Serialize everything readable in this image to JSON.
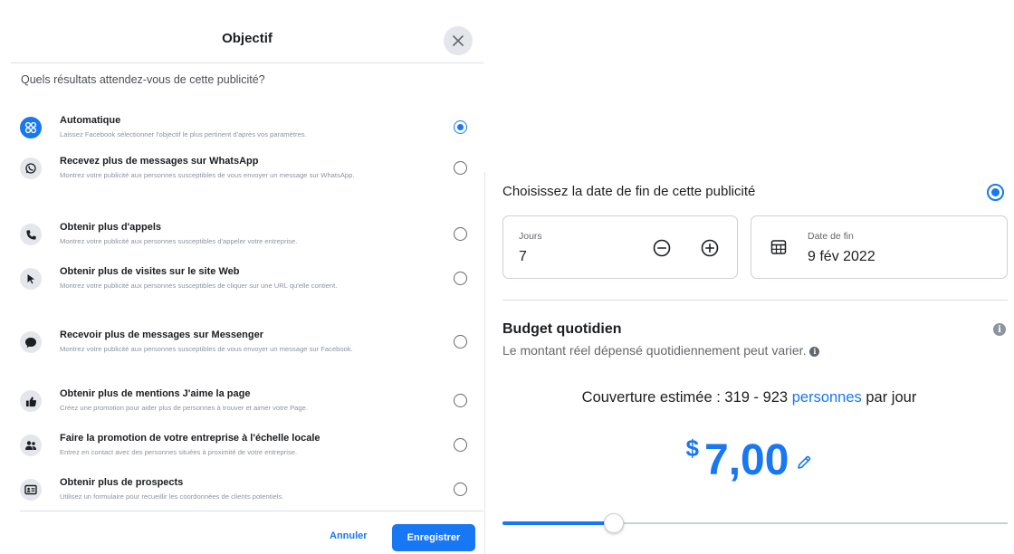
{
  "dialog": {
    "title": "Objectif",
    "question": "Quels résultats attendez-vous de cette publicité?",
    "options": [
      {
        "icon": "grid-dots-icon",
        "title": "Automatique",
        "desc": "Laissez Facebook sélectionner l'objectif le plus pertinent d'après vos paramètres.",
        "selected": true
      },
      {
        "icon": "whatsapp-icon",
        "title": "Recevez plus de messages sur WhatsApp",
        "desc": "Montrez votre publicité aux personnes susceptibles de vous envoyer un message sur WhatsApp.",
        "selected": false
      },
      {
        "icon": "phone-icon",
        "title": "Obtenir plus d'appels",
        "desc": "Montrez votre publicité aux personnes susceptibles d'appeler votre entreprise.",
        "selected": false
      },
      {
        "icon": "cursor-icon",
        "title": "Obtenir plus de visites sur le site Web",
        "desc": "Montrez votre publicité aux personnes susceptibles de cliquer sur une URL qu'elle contient.",
        "selected": false
      },
      {
        "icon": "chat-bubble-icon",
        "title": "Recevoir plus de messages sur Messenger",
        "desc": "Montrez votre publicité aux personnes susceptibles de vous envoyer un message sur Facebook.",
        "selected": false
      },
      {
        "icon": "thumbs-up-icon",
        "title": "Obtenir plus de mentions J'aime la page",
        "desc": "Créez une promotion pour aider plus de personnes à trouver et aimer votre Page.",
        "selected": false
      },
      {
        "icon": "people-icon",
        "title": "Faire la promotion de votre entreprise à l'échelle locale",
        "desc": "Entrez en contact avec des personnes situées à proximité de votre entreprise.",
        "selected": false
      },
      {
        "icon": "contact-card-icon",
        "title": "Obtenir plus de prospects",
        "desc": "Utilisez un formulaire pour recueillir les coordonnées de clients potentiels.",
        "selected": false
      }
    ],
    "cancel_label": "Annuler",
    "save_label": "Enregistrer"
  },
  "schedule": {
    "title": "Choisissez la date de fin de cette publicité",
    "selected": true,
    "days_label": "Jours",
    "days_value": "7",
    "end_date_label": "Date de fin",
    "end_date_value": "9 fév 2022"
  },
  "budget": {
    "title": "Budget quotidien",
    "subtitle": "Le montant réel dépensé quotidiennement peut varier.",
    "reach_prefix": "Couverture estimée : 319 - 923",
    "reach_link": "personnes",
    "reach_suffix": "par jour",
    "currency": "$",
    "amount": "7,00",
    "slider_fraction": 0.22
  },
  "colors": {
    "accent": "#1877f2",
    "text": "#1c1e21",
    "muted": "#65676b"
  }
}
